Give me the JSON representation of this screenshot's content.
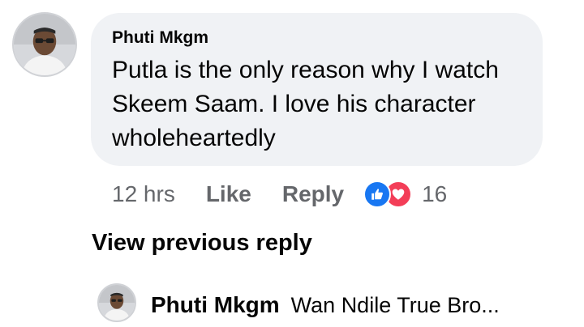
{
  "comment": {
    "author": "Phuti Mkgm",
    "text": "Putla is the only reason why I watch Skeem Saam. I love his character wholeheartedly",
    "time": "12 hrs",
    "like_label": "Like",
    "reply_label": "Reply",
    "reactions": {
      "types": [
        "like-icon",
        "love-icon"
      ],
      "count": "16",
      "colors": {
        "like": "#1877f2",
        "love": "#f33e58"
      }
    }
  },
  "replies": {
    "view_previous_label": "View previous reply",
    "preview": {
      "author": "Phuti Mkgm",
      "text": "Wan Ndile True Bro..."
    }
  },
  "colors": {
    "bubble": "#f0f2f5",
    "secondary_text": "#65676b",
    "primary_text": "#050505"
  }
}
